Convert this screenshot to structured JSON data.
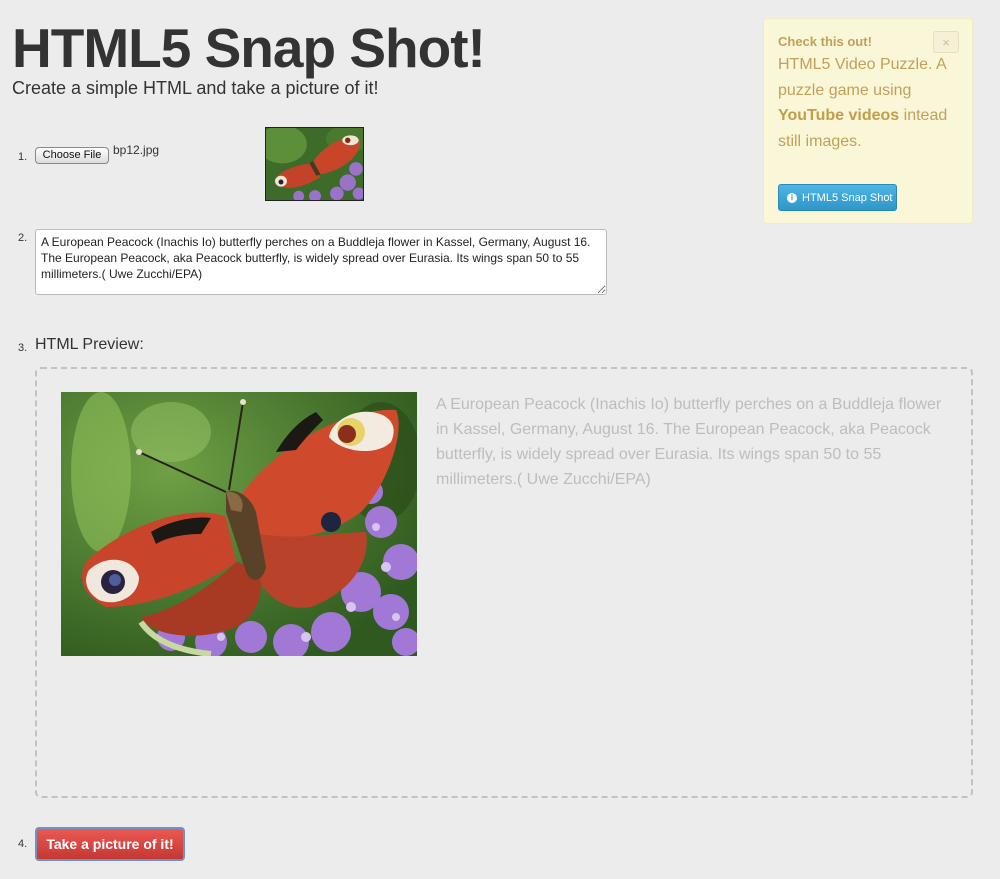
{
  "header": {
    "title": "HTML5 Snap Shot!",
    "subtitle": "Create a simple HTML and take a picture of it!"
  },
  "steps": {
    "one": "1.",
    "two": "2.",
    "three": "3.",
    "four": "4."
  },
  "file_input": {
    "button_label": "Choose File",
    "file_name": "bp12.jpg"
  },
  "caption": {
    "value": "A European Peacock (Inachis Io) butterfly perches on a Buddleja flower in Kassel, Germany, August 16. The European Peacock, aka Peacock butterfly, is widely spread over Eurasia. Its wings span 50 to 55 millimeters.( Uwe Zucchi/EPA)"
  },
  "preview": {
    "label": "HTML Preview:",
    "text": "A European Peacock (Inachis Io) butterfly perches on a Buddleja flower in Kassel, Germany, August 16. The European Peacock, aka Peacock butterfly, is widely spread over Eurasia. Its wings span 50 to 55 millimeters.( Uwe Zucchi/EPA)"
  },
  "snap_button": {
    "label": "Take a picture of it!"
  },
  "notice": {
    "heading": "Check this out!",
    "body_part1": "HTML5 Video Puzzle. A puzzle game using ",
    "body_bold": "YouTube videos",
    "body_part2": " intead still images.",
    "close_label": "×",
    "button_label": "HTML5 Snap Shot",
    "button_icon": "info-icon"
  },
  "colors": {
    "background": "#ececec",
    "notice_background": "#faf6d8",
    "notice_text": "#c0a15a",
    "snap_button": "#d9443f",
    "info_button": "#3ba4d8",
    "preview_text": "#bdbdbd"
  }
}
